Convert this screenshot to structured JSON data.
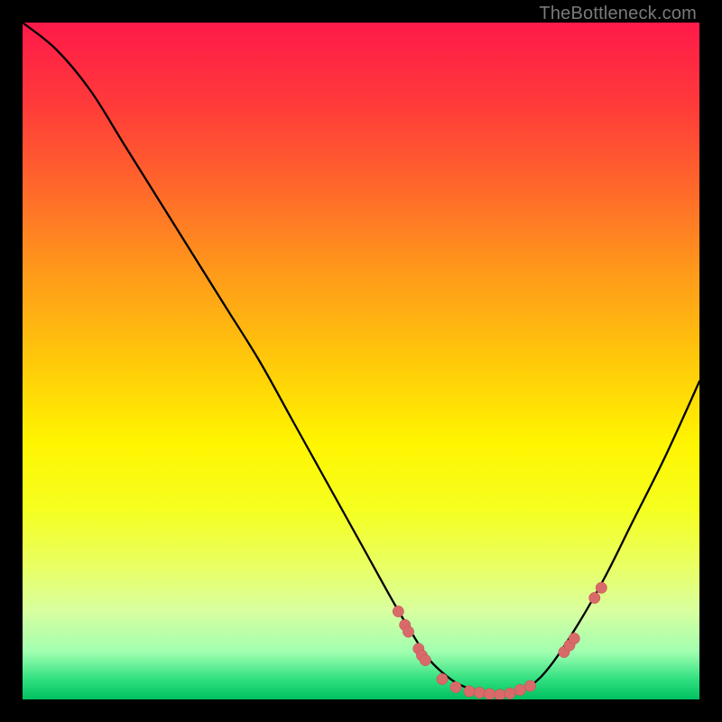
{
  "watermark": "TheBottleneck.com",
  "colors": {
    "frame": "#000000",
    "curve": "#000000",
    "dot_fill": "#d96a6a",
    "dot_stroke": "#c45050"
  },
  "chart_data": {
    "type": "line",
    "title": "",
    "xlabel": "",
    "ylabel": "",
    "xlim": [
      0,
      100
    ],
    "ylim": [
      0,
      100
    ],
    "grid": false,
    "legend": false,
    "series": [
      {
        "name": "bottleneck-curve",
        "x": [
          0,
          5,
          10,
          15,
          20,
          25,
          30,
          35,
          40,
          45,
          50,
          55,
          58,
          60,
          62,
          64,
          66,
          68,
          70,
          72,
          75,
          78,
          82,
          86,
          90,
          95,
          100
        ],
        "y": [
          100,
          96,
          90,
          82,
          74,
          66,
          58,
          50,
          41,
          32,
          23,
          14,
          9,
          6,
          4,
          2.5,
          1.6,
          1.0,
          0.7,
          0.9,
          2.0,
          5,
          11,
          18,
          26,
          36,
          47
        ]
      }
    ],
    "markers": [
      {
        "x": 55.5,
        "y": 13.0
      },
      {
        "x": 56.5,
        "y": 11.0
      },
      {
        "x": 57.0,
        "y": 10.0
      },
      {
        "x": 58.5,
        "y": 7.5
      },
      {
        "x": 59.0,
        "y": 6.5
      },
      {
        "x": 59.5,
        "y": 5.8
      },
      {
        "x": 62.0,
        "y": 3.0
      },
      {
        "x": 64.0,
        "y": 1.8
      },
      {
        "x": 66.0,
        "y": 1.2
      },
      {
        "x": 67.5,
        "y": 1.0
      },
      {
        "x": 69.0,
        "y": 0.8
      },
      {
        "x": 70.5,
        "y": 0.7
      },
      {
        "x": 72.0,
        "y": 0.9
      },
      {
        "x": 73.5,
        "y": 1.4
      },
      {
        "x": 75.0,
        "y": 2.0
      },
      {
        "x": 80.0,
        "y": 7.0
      },
      {
        "x": 80.8,
        "y": 8.0
      },
      {
        "x": 81.5,
        "y": 9.0
      },
      {
        "x": 84.5,
        "y": 15.0
      },
      {
        "x": 85.5,
        "y": 16.5
      }
    ]
  }
}
